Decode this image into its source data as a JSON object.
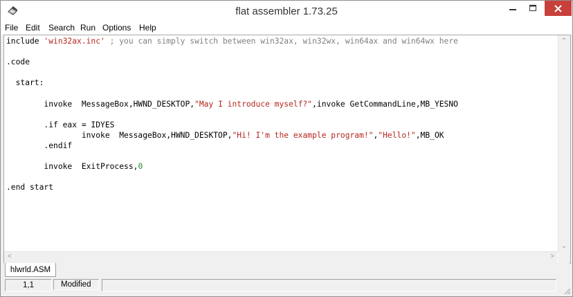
{
  "window": {
    "title": "flat assembler 1.73.25",
    "close_color": "#c7413a"
  },
  "menu": [
    {
      "label": "File"
    },
    {
      "label": "Edit"
    },
    {
      "label": "Search"
    },
    {
      "label": "Run"
    },
    {
      "label": "Options"
    },
    {
      "label": "Help"
    }
  ],
  "editor": {
    "lines": [
      [
        {
          "t": "include ",
          "c": "kw"
        },
        {
          "t": "'win32ax.inc'",
          "c": "str"
        },
        {
          "t": " ; you can simply switch between win32ax, win32wx, win64ax and win64wx here",
          "c": "cmt"
        }
      ],
      [],
      [
        {
          "t": ".code",
          "c": "kw"
        }
      ],
      [],
      [
        {
          "t": "  start:",
          "c": "kw"
        }
      ],
      [],
      [
        {
          "t": "        invoke  MessageBox,HWND_DESKTOP,",
          "c": "kw"
        },
        {
          "t": "\"May I introduce myself?\"",
          "c": "str"
        },
        {
          "t": ",invoke GetCommandLine,MB_YESNO",
          "c": "kw"
        }
      ],
      [],
      [
        {
          "t": "        .if eax = IDYES",
          "c": "kw"
        }
      ],
      [
        {
          "t": "                invoke  MessageBox,HWND_DESKTOP,",
          "c": "kw"
        },
        {
          "t": "\"Hi! I'm the example program!\"",
          "c": "str"
        },
        {
          "t": ",",
          "c": "kw"
        },
        {
          "t": "\"Hello!\"",
          "c": "str"
        },
        {
          "t": ",MB_OK",
          "c": "kw"
        }
      ],
      [
        {
          "t": "        .endif",
          "c": "kw"
        }
      ],
      [],
      [
        {
          "t": "        invoke  ExitProcess,",
          "c": "kw"
        },
        {
          "t": "0",
          "c": "num"
        }
      ],
      [],
      [
        {
          "t": ".end start",
          "c": "kw"
        }
      ]
    ]
  },
  "tabs": [
    {
      "label": "hlwrld.ASM",
      "active": true
    }
  ],
  "status": {
    "position": "1,1",
    "state": "Modified"
  },
  "colors": {
    "string": "#b3261e",
    "number": "#228b22",
    "comment": "#808080"
  }
}
